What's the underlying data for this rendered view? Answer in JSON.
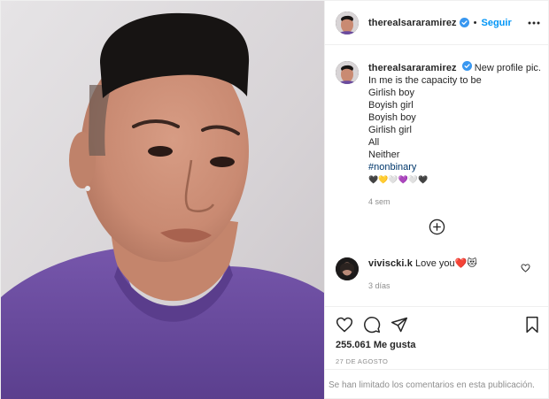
{
  "header": {
    "username": "therealsararamirez",
    "separator": "•",
    "follow_label": "Seguir",
    "verified_icon": "verified-badge-icon",
    "more_icon": "more-options-icon"
  },
  "caption": {
    "username": "therealsararamirez",
    "lines": [
      "New profile pic.",
      "In me is the capacity to be",
      "Girlish boy",
      "Boyish girl",
      "Boyish boy",
      "Girlish girl",
      "All",
      "Neither"
    ],
    "hashtag": "#nonbinary",
    "emoji_line": "🖤💛🤍💜🤍🖤",
    "time": "4 sem"
  },
  "load_more_icon": "plus-circle-icon",
  "comment": {
    "username": "vivisckі.k",
    "text": "Love you❤️😻",
    "time": "3 días",
    "like_icon": "heart-outline-icon"
  },
  "actions": {
    "like_icon": "heart-icon",
    "comment_icon": "comment-icon",
    "share_icon": "send-icon",
    "save_icon": "bookmark-icon",
    "likes": "255.061 Me gusta",
    "date": "27 DE AGOSTO"
  },
  "footer": {
    "text": "Se han limitado los comentarios en esta publicación."
  },
  "colors": {
    "accent": "#0095f6",
    "text": "#262626",
    "muted": "#8e8e8e",
    "hashtag": "#00376b",
    "border": "#efefef",
    "shirt": "#6a4a9e"
  }
}
